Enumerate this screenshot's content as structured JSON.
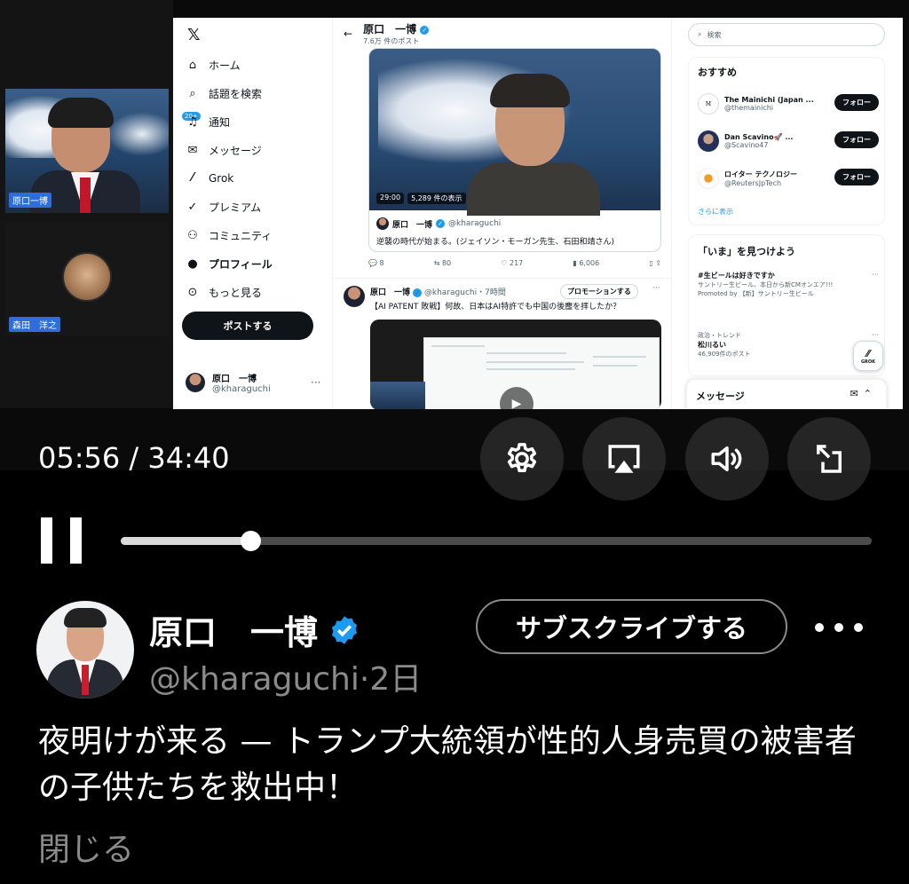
{
  "player": {
    "current_time": "05:56",
    "separator": " / ",
    "duration": "34:40",
    "progress": 0.172
  },
  "participants": [
    {
      "name": "原口一博"
    },
    {
      "name": "森田　洋之"
    }
  ],
  "shared_screen": {
    "nav": {
      "logo": "𝕏",
      "items": [
        "ホーム",
        "話題を検索",
        "通知",
        "メッセージ",
        "Grok",
        "プレミアム",
        "コミュニティ",
        "プロフィール",
        "もっと見る"
      ],
      "notif_badge": "20+",
      "post_button": "ポストする",
      "account_name": "原口　一博",
      "account_handle": "@kharaguchi"
    },
    "header": {
      "name": "原口　一博",
      "posts": "7.6万 件のポスト"
    },
    "pinned": {
      "time": "29:00",
      "views": "5,289 件の表示",
      "author": "原口　一博",
      "handle": "@kharaguchi",
      "text": "逆襲の時代が始まる。(ジェイソン・モーガン先生、石田和靖さん)",
      "replies": "8",
      "reposts": "80",
      "likes": "217",
      "views_count": "6,006"
    },
    "tweet2": {
      "author": "原口　一博",
      "handle": "@kharaguchi・7時間",
      "promo": "プロモーションする",
      "text": "【AI PATENT 敗戦】何故、日本はAI特許でも中国の後塵を拝したか？"
    },
    "sidebar": {
      "search_placeholder": "検索",
      "recommend_title": "おすすめ",
      "recommendations": [
        {
          "name": "The Mainichi (Japan ...",
          "handle": "@themainichi",
          "follow": "フォロー"
        },
        {
          "name": "Dan Scavino🚀 ...",
          "handle": "@Scavino47",
          "follow": "フォロー"
        },
        {
          "name": "ロイター テクノロジー",
          "handle": "@ReutersJpTech",
          "follow": "フォロー"
        }
      ],
      "show_more": "さらに表示",
      "discover_title": "「いま」を見つけよう",
      "trends": [
        {
          "title": "#生ビールは好きですか",
          "sub": "サントリー生ビール、本日から新CMオンエア!!!",
          "meta": "Promoted by 【新】サントリー生ビール"
        },
        {
          "category": "政治・トレンド",
          "title": "松川るい",
          "sub": "46,909件のポスト"
        }
      ],
      "grok_label": "GROK",
      "messages_title": "メッセージ"
    }
  },
  "post": {
    "name": "原口　一博",
    "handle": "@kharaguchi",
    "age": "·2日",
    "subscribe": "サブスクライブする",
    "text": "夜明けが来る — トランプ大統領が性的人身売買の被害者の子供たちを救出中！",
    "close": "閉じる"
  },
  "colors": {
    "background": "#000000",
    "verified": "#1d9bf0",
    "muted_text": "#8b8b8b",
    "track": "#4b4b4b"
  },
  "icons": [
    "gear-icon",
    "airplay-icon",
    "speaker-icon",
    "rotate-icon",
    "pause-icon",
    "verified-icon",
    "more-icon"
  ]
}
